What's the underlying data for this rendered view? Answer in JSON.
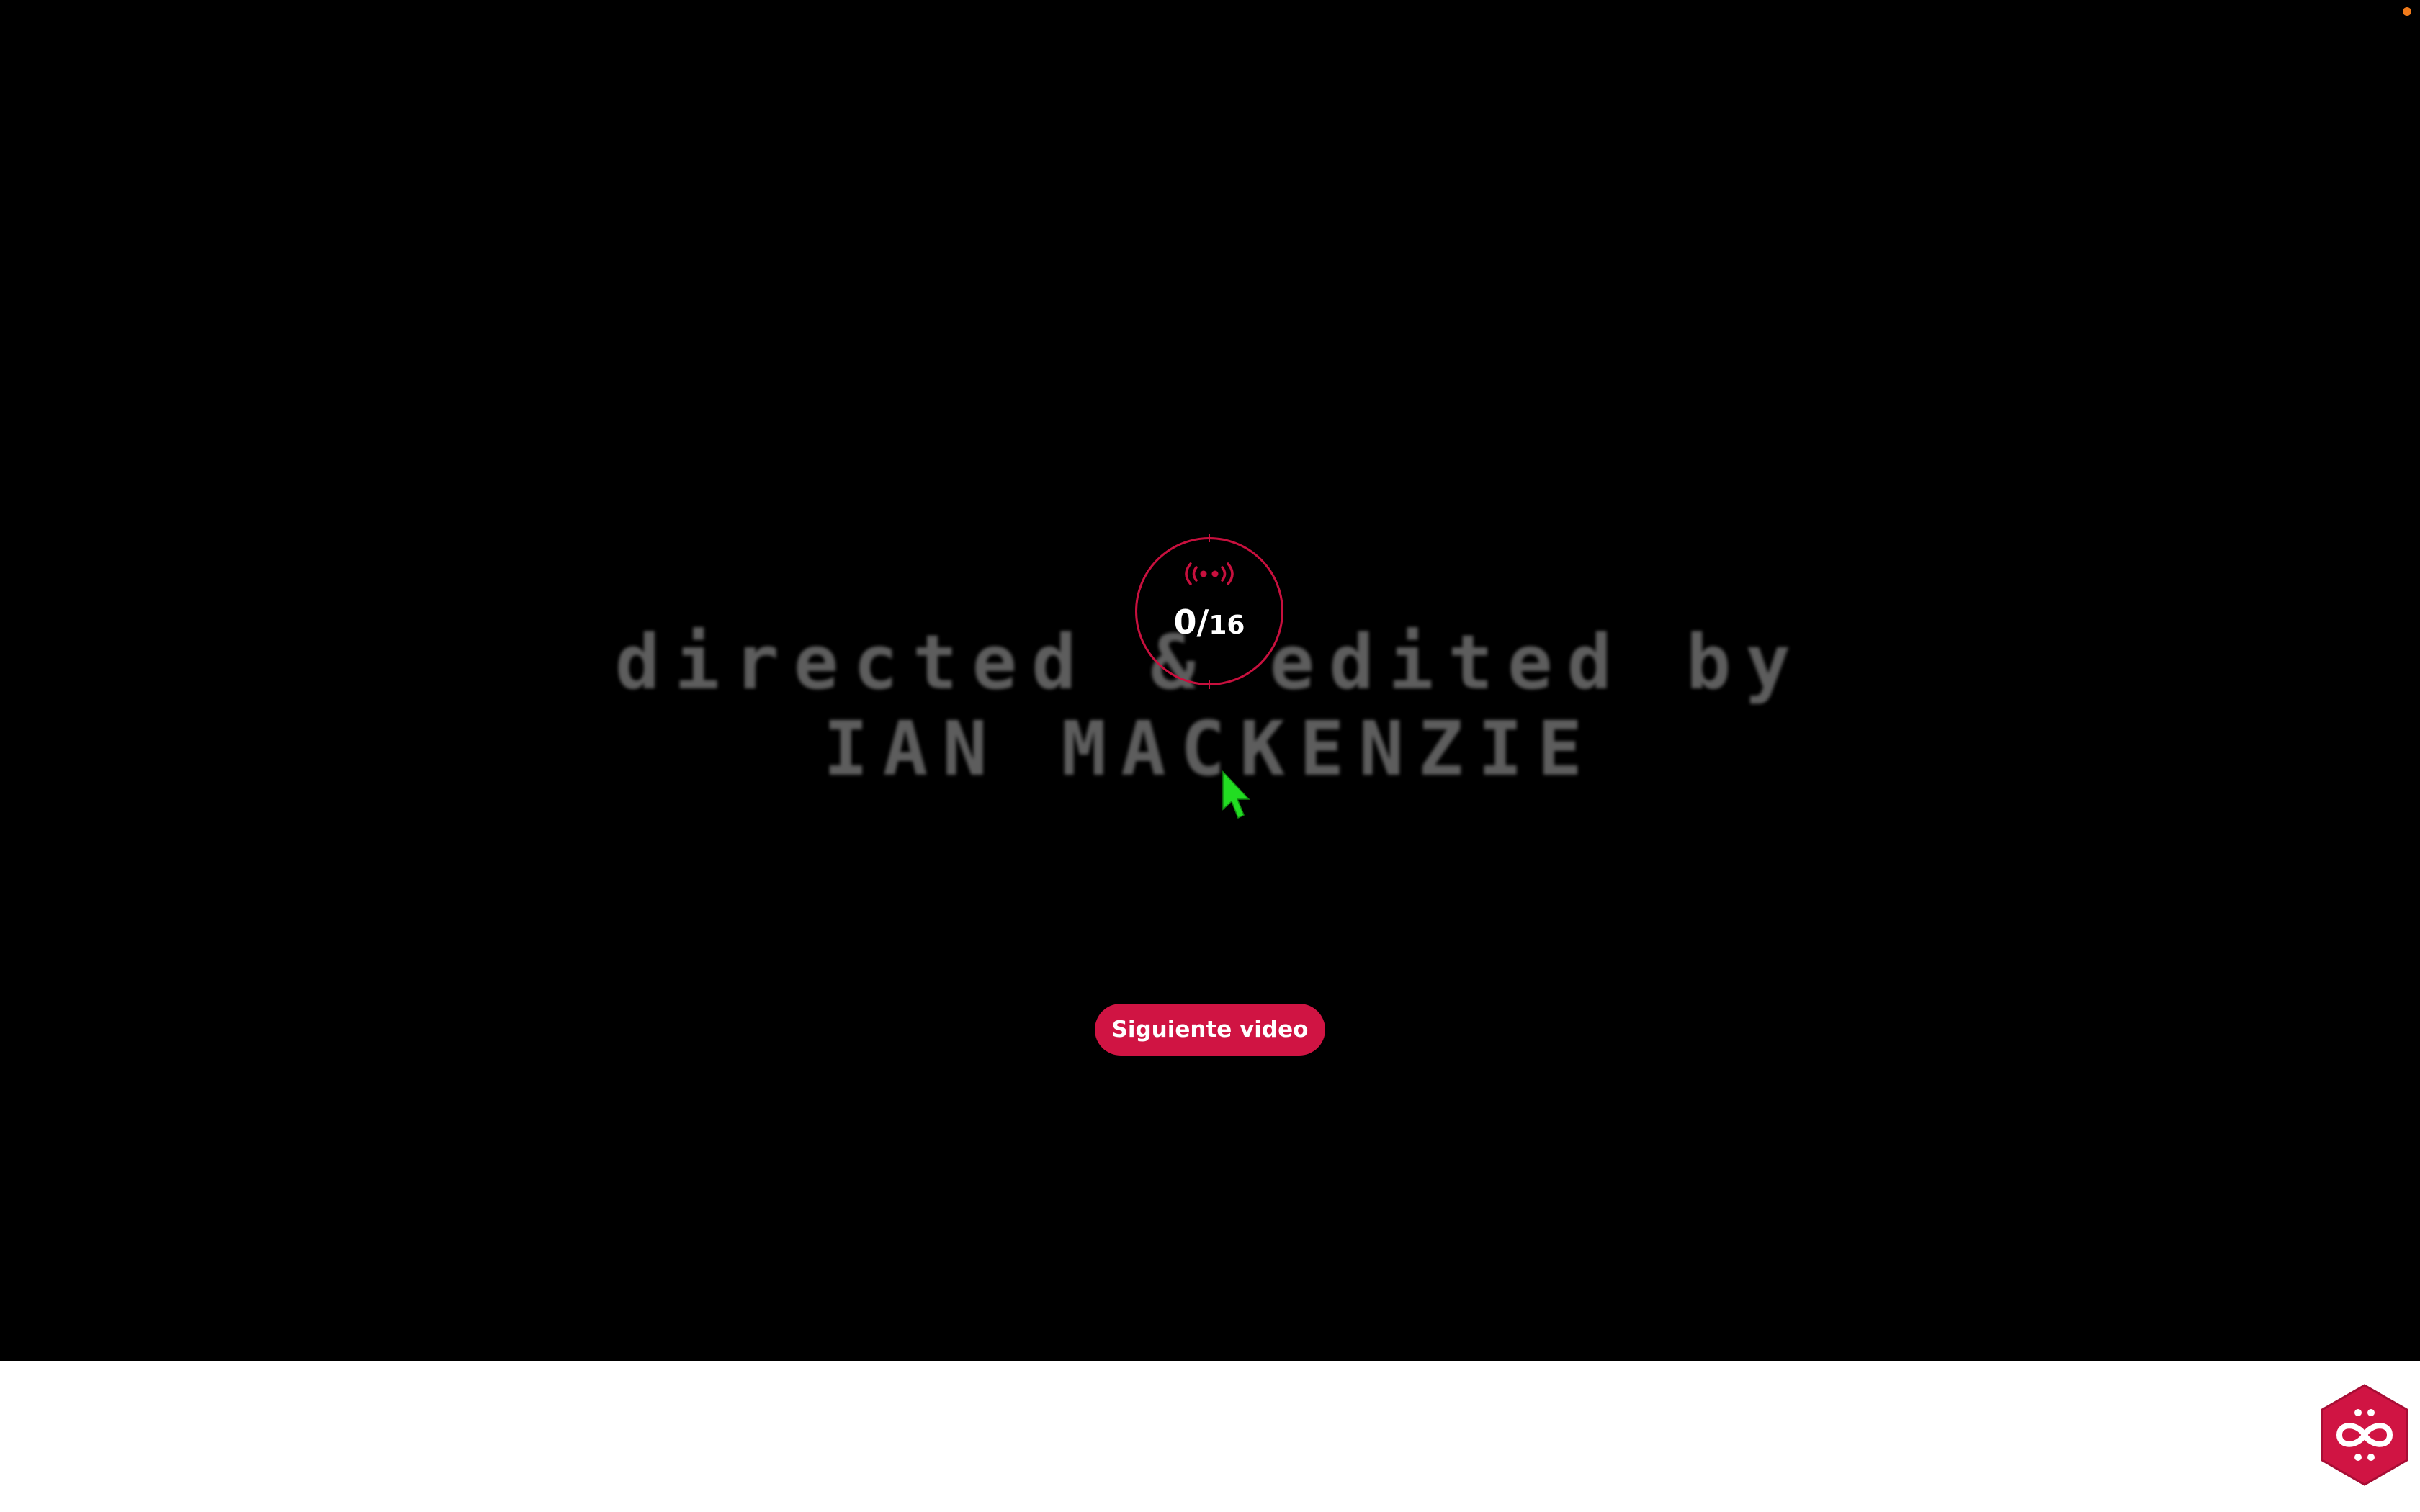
{
  "video": {
    "credits_line1": "directed & edited by",
    "credits_line2": "IAN MACKENZIE"
  },
  "counter": {
    "icon": "live-broadcast-icon",
    "current": "0",
    "separator": "/",
    "total": "16"
  },
  "actions": {
    "next_video_label": "Siguiente video"
  },
  "badge": {
    "icon": "infinity-hexagon-icon"
  },
  "colors": {
    "accent": "#d01443",
    "background": "#000000",
    "footer": "#ffffff",
    "cursor": "#22dd22",
    "notification_dot": "#f07a1a"
  }
}
